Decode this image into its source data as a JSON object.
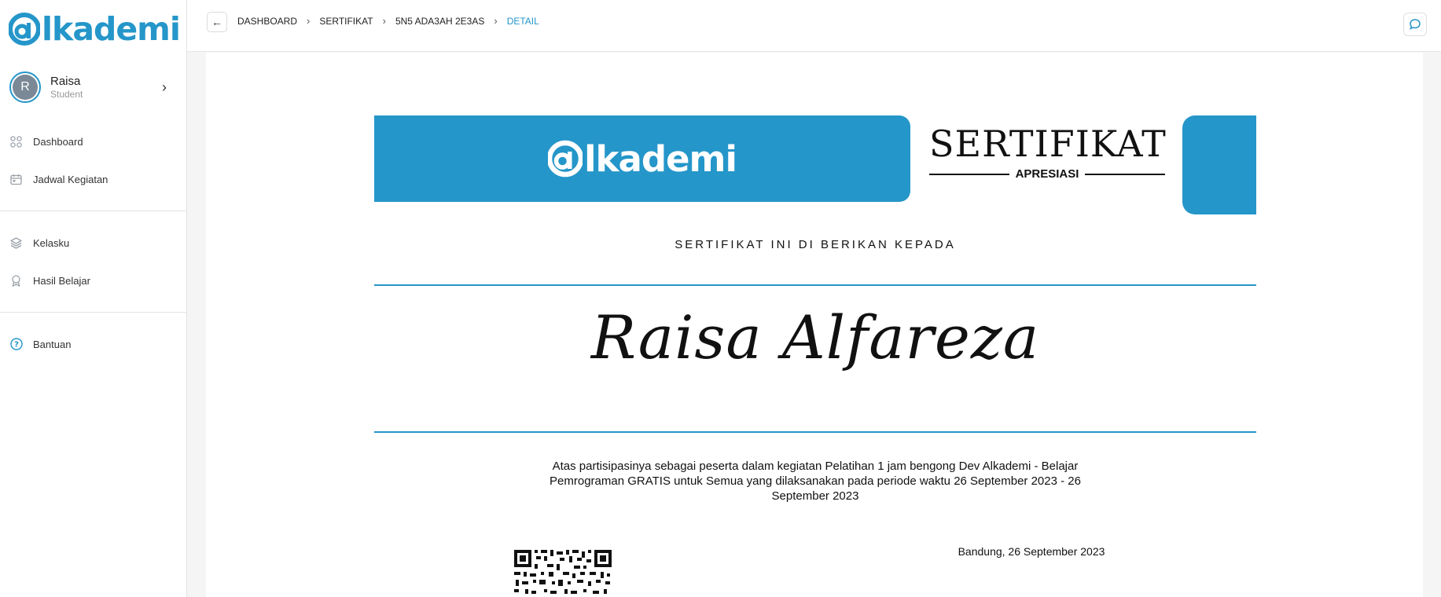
{
  "sidebar": {
    "logo_text": "lkademi",
    "user": {
      "initial": "R",
      "name": "Raisa",
      "role": "Student"
    },
    "nav_primary": [
      {
        "label": "Dashboard",
        "icon": "grid-icon"
      },
      {
        "label": "Jadwal Kegiatan",
        "icon": "calendar-icon"
      }
    ],
    "nav_secondary": [
      {
        "label": "Kelasku",
        "icon": "layers-icon"
      },
      {
        "label": "Hasil Belajar",
        "icon": "award-icon"
      }
    ],
    "nav_help": [
      {
        "label": "Bantuan",
        "icon": "help-circle-icon"
      }
    ]
  },
  "topbar": {
    "breadcrumbs": [
      "DASHBOARD",
      "SERTIFIKAT",
      "5N5 ADA3AH 2E3AS",
      "DETAIL"
    ]
  },
  "certificate": {
    "banner_logo_text": "lkademi",
    "title": "SERTIFIKAT",
    "subtitle": "APRESIASI",
    "given_to": "SERTIFIKAT INI DI BERIKAN KEPADA",
    "recipient": "Raisa Alfareza",
    "description": "Atas partisipasinya sebagai peserta dalam kegiatan Pelatihan 1 jam bengong Dev Alkademi - Belajar Pemrograman GRATIS untuk Semua yang dilaksanakan pada periode waktu 26 September 2023 - 26 September 2023",
    "place_date": "Bandung, 26 September 2023"
  },
  "colors": {
    "accent": "#2596c9"
  }
}
